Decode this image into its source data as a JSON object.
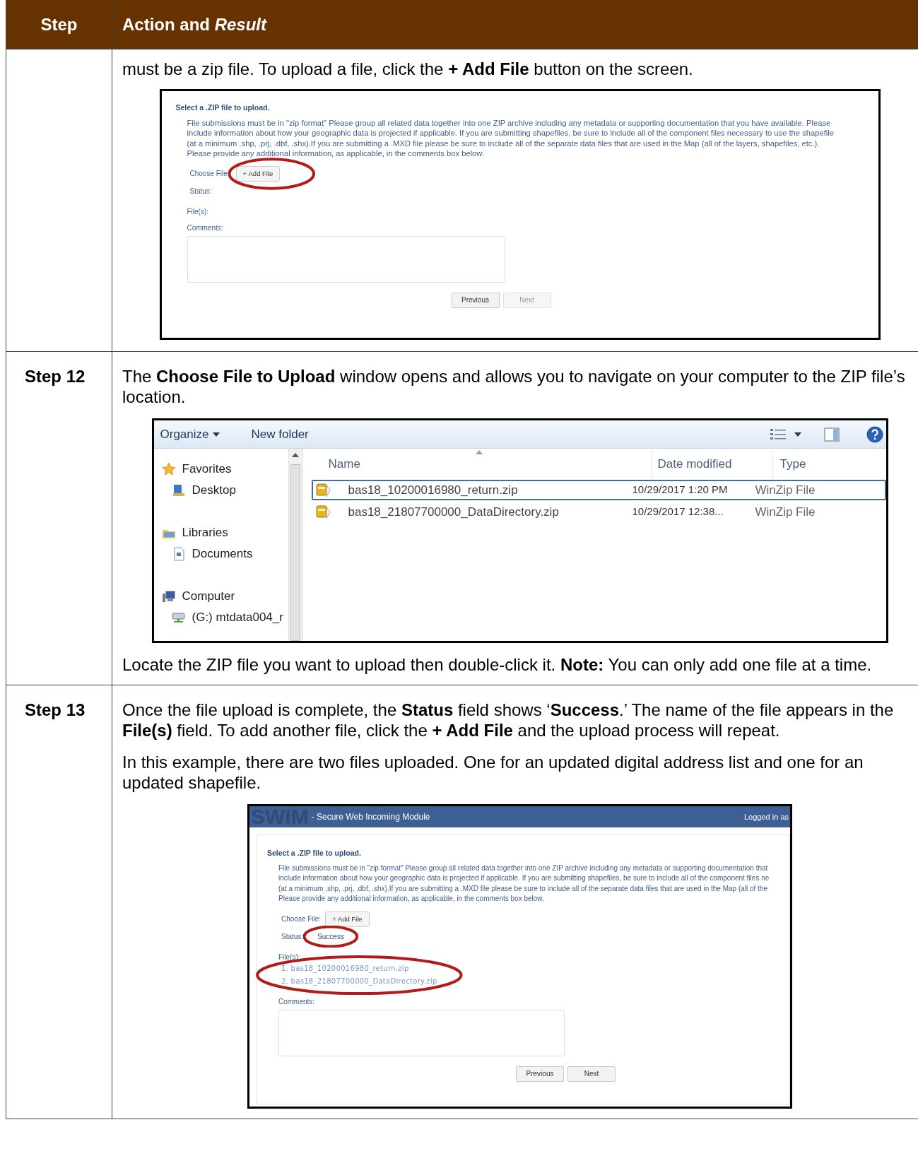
{
  "table": {
    "columns": [
      {
        "label": "Step"
      },
      {
        "label": "Action and *Result*"
      }
    ],
    "rows": [
      {
        "blocks": [
          {
            "kind": "text",
            "text": "must be a zip file. To upload a file, click the **+ Add File** button on the screen."
          },
          {
            "kind": "upload_form",
            "heading": "Select a .ZIP file to upload.",
            "instructions": [
              "File submissions must be in \"zip format\" Please group all related data together into one ZIP archive including any metadata or supporting documentation that you have available. Please",
              "include information about how your geographic data is projected if applicable. If you are submitting shapefiles, be sure to include all of the component files necessary to use the shapefile",
              "(at a minimum .shp, .prj, .dbf, .shx).If you are submitting a .MXD file please be sure to include all of the separate data files that are used in the Map (all of the layers, shapefiles, etc.).",
              "Please provide any additional information, as applicable, in the comments box below."
            ],
            "choose_file_label": "Choose File",
            "add_file_button": "+ Add File",
            "status_label": "Status:",
            "files_label": "File(s):",
            "comments_label": "Comments:",
            "buttons": [
              {
                "label": "Previous",
                "disabled": false
              },
              {
                "label": "Next",
                "disabled": true
              }
            ],
            "add_file_circled": true
          }
        ]
      },
      {
        "step": "Step 12",
        "blocks": [
          {
            "kind": "text",
            "text": "The **Choose File to Upload** window opens and allows you to navigate on your computer to the ZIP file’s location."
          },
          {
            "kind": "file_dialog",
            "toolbar": {
              "organize": "Organize",
              "new_folder": "New folder"
            },
            "nav": [
              {
                "label": "Favorites",
                "children": [
                  {
                    "label": "Desktop"
                  }
                ]
              },
              {
                "label": "Libraries",
                "children": [
                  {
                    "label": "Documents"
                  }
                ]
              },
              {
                "label": "Computer",
                "children": [
                  {
                    "label": "(G:) mtdata004_r"
                  }
                ]
              }
            ],
            "columns": [
              "Name",
              "Date modified",
              "Type"
            ],
            "files": [
              {
                "name": "bas18_10200016980_return.zip",
                "date": "10/29/2017 1:20 PM",
                "type": "WinZip File",
                "selected": true
              },
              {
                "name": "bas18_21807700000_DataDirectory.zip",
                "date": "10/29/2017 12:38...",
                "type": "WinZip File",
                "selected": false
              }
            ]
          },
          {
            "kind": "text",
            "text": "Locate the ZIP file you want to upload then double-click it. **Note:**  You can only add one file at a time."
          }
        ]
      },
      {
        "step": "Step 13",
        "blocks": [
          {
            "kind": "text",
            "text": "Once the file upload is complete, the **Status** field shows ‘**Success**.’ The name of the file appears in the **File(s)** field. To add another file, click the **+ Add File** and the upload process will repeat."
          },
          {
            "kind": "text",
            "text": "In this example, there are two files uploaded. One for an updated digital address list and one for an updated shapefile."
          },
          {
            "kind": "upload_form",
            "app_bar": {
              "logo": "SWIM",
              "title": "- Secure Web Incoming Module",
              "user": "Logged in as"
            },
            "heading": "Select a .ZIP file to upload.",
            "instructions": [
              "File submissions must be in \"zip format\" Please group all related data together into one ZIP archive including any metadata or supporting documentation that",
              "include information about how your geographic data is projected if applicable. If you are submitting shapefiles, be sure to include all of the component files ne",
              "(at a minimum .shp, .prj, .dbf, .shx).If you are submitting a .MXD file please be sure to include all of the separate data files that are used in the Map (all of the",
              "Please provide any additional information, as applicable, in the comments box below."
            ],
            "choose_file_label": "Choose File:",
            "add_file_button": "+ Add File",
            "status_label": "Status:",
            "status_value": "Success",
            "files_label": "File(s):",
            "files": [
              "1. bas18_10200016980_return.zip",
              "2. bas18_21807700000_DataDirectory.zip"
            ],
            "comments_label": "Comments:",
            "buttons": [
              {
                "label": "Previous",
                "disabled": false
              },
              {
                "label": "Next",
                "disabled": false
              }
            ],
            "status_circled": true,
            "files_circled": true
          }
        ]
      }
    ]
  }
}
